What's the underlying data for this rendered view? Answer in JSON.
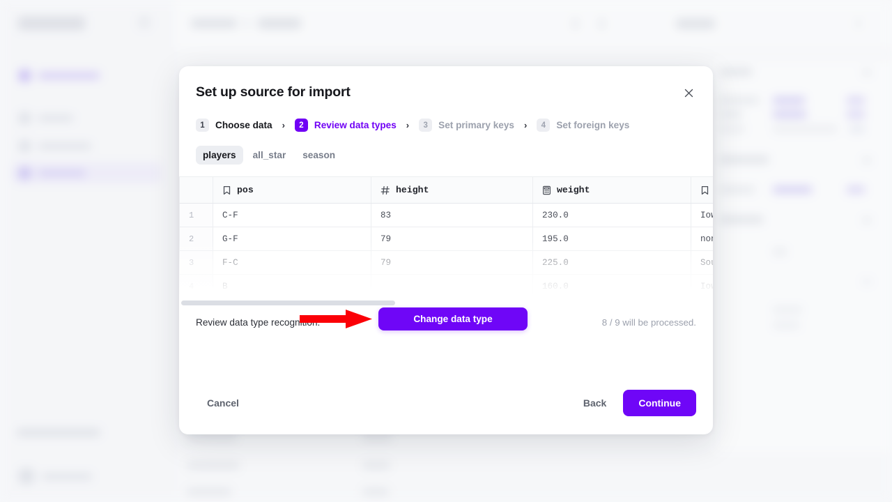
{
  "modal": {
    "title": "Set up source for import",
    "close_icon": "close-icon",
    "steps": [
      {
        "number": "1",
        "label": "Choose data",
        "state": "done"
      },
      {
        "number": "2",
        "label": "Review data types",
        "state": "current"
      },
      {
        "number": "3",
        "label": "Set primary keys",
        "state": "upcoming"
      },
      {
        "number": "4",
        "label": "Set foreign keys",
        "state": "upcoming"
      }
    ],
    "step_separator": "›",
    "tabs": [
      {
        "label": "players",
        "active": true
      },
      {
        "label": "all_star",
        "active": false
      },
      {
        "label": "season",
        "active": false
      }
    ],
    "table": {
      "columns": [
        {
          "name": "",
          "icon": ""
        },
        {
          "name": "pos",
          "icon": "bookmark-icon"
        },
        {
          "name": "height",
          "icon": "hash-icon"
        },
        {
          "name": "weight",
          "icon": "calculator-icon"
        },
        {
          "name": "",
          "icon": "bookmark-icon"
        }
      ],
      "rows": [
        {
          "index": "1",
          "pos": "C-F",
          "height": "83",
          "weight": "230.0",
          "col5": "Iow"
        },
        {
          "index": "2",
          "pos": "G-F",
          "height": "79",
          "weight": "195.0",
          "col5": "non"
        },
        {
          "index": "3",
          "pos": "F-C",
          "height": "79",
          "weight": "225.0",
          "col5": "Sou"
        },
        {
          "index": "4",
          "pos": "B",
          "height": "",
          "weight": "160.0",
          "col5": "Iow"
        }
      ]
    },
    "overlay_button": {
      "label": "Change data type"
    },
    "status": {
      "message": "Review data type recognition.",
      "processed": "8 / 9 will be processed."
    },
    "footer": {
      "cancel": "Cancel",
      "back": "Back",
      "continue": "Continue"
    }
  },
  "annotation": {
    "arrow_color": "#fb0007",
    "points_at": "Change data type"
  },
  "colors": {
    "accent": "#7000f5",
    "primary_button": "#6f06f7",
    "arrow": "#fb0007"
  }
}
